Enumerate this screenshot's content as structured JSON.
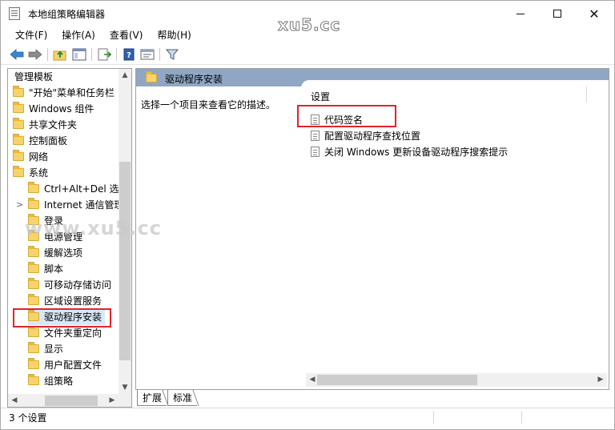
{
  "window": {
    "title": "本地组策略编辑器",
    "watermark": "xu5.cc",
    "watermark_mid": "www.xu5.cc"
  },
  "menu": {
    "items": [
      "文件(F)",
      "操作(A)",
      "查看(V)",
      "帮助(H)"
    ]
  },
  "toolbar": {
    "buttons": [
      "back-arrow-icon",
      "forward-arrow-icon",
      "up-folder-icon",
      "show-hide-tree-icon",
      "export-list-icon",
      "help-icon",
      "properties-icon",
      "filter-icon"
    ]
  },
  "tree": {
    "items": [
      {
        "label": "管理模板",
        "level": 0,
        "icon": "none"
      },
      {
        "label": "\"开始\"菜单和任务栏",
        "level": 0,
        "icon": "folder"
      },
      {
        "label": "Windows 组件",
        "level": 0,
        "icon": "folder"
      },
      {
        "label": "共享文件夹",
        "level": 0,
        "icon": "folder"
      },
      {
        "label": "控制面板",
        "level": 0,
        "icon": "folder"
      },
      {
        "label": "网络",
        "level": 0,
        "icon": "folder"
      },
      {
        "label": "系统",
        "level": 0,
        "icon": "folder"
      },
      {
        "label": "Ctrl+Alt+Del 选项",
        "level": 1,
        "icon": "folder"
      },
      {
        "label": "Internet 通信管理",
        "level": 1,
        "icon": "folder",
        "expandable": true
      },
      {
        "label": "登录",
        "level": 1,
        "icon": "folder"
      },
      {
        "label": "电源管理",
        "level": 1,
        "icon": "folder"
      },
      {
        "label": "缓解选项",
        "level": 1,
        "icon": "folder"
      },
      {
        "label": "脚本",
        "level": 1,
        "icon": "folder"
      },
      {
        "label": "可移动存储访问",
        "level": 1,
        "icon": "folder"
      },
      {
        "label": "区域设置服务",
        "level": 1,
        "icon": "folder"
      },
      {
        "label": "驱动程序安装",
        "level": 1,
        "icon": "folder",
        "selected": true
      },
      {
        "label": "文件夹重定向",
        "level": 1,
        "icon": "folder"
      },
      {
        "label": "显示",
        "level": 1,
        "icon": "folder"
      },
      {
        "label": "用户配置文件",
        "level": 1,
        "icon": "folder"
      },
      {
        "label": "组策略",
        "level": 1,
        "icon": "folder"
      }
    ]
  },
  "details": {
    "header_title": "驱动程序安装",
    "description": "选择一个项目来查看它的描述。",
    "column_header": "设置",
    "rows": [
      "代码签名",
      "配置驱动程序查找位置",
      "关闭 Windows 更新设备驱动程序搜索提示"
    ]
  },
  "tabs": [
    "扩展",
    "标准"
  ],
  "status": {
    "text": "3 个设置"
  },
  "colors": {
    "header_bg": "#8fa7c4",
    "highlight": "#e0242c",
    "folder": "#f5d46a"
  }
}
